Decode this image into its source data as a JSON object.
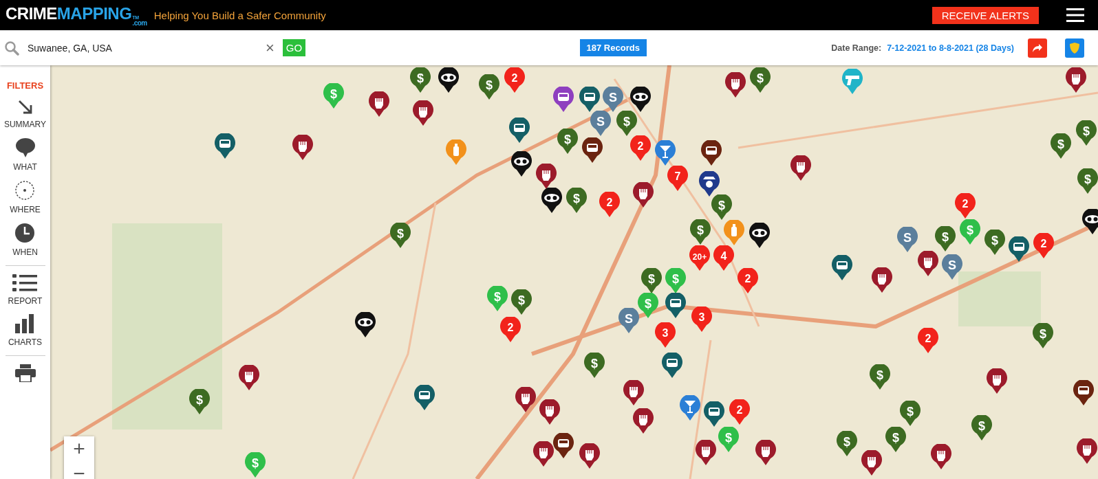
{
  "header": {
    "logo": {
      "primary": "CRIME",
      "secondary": "MAPPING",
      "trademark": "TM",
      "suffix": ".com"
    },
    "tagline": "Helping You Build a Safer Community",
    "alerts_button": "RECEIVE ALERTS"
  },
  "toolbar": {
    "search": {
      "value": "Suwanee, GA, USA"
    },
    "clear_button": "×",
    "go_button": "GO",
    "records": "187 Records",
    "date_range_label": "Date Range:",
    "date_range": "7-12-2021 to 8-8-2021 (28 Days)"
  },
  "sidebar": {
    "title": "FILTERS",
    "items": [
      {
        "kind": "summary",
        "label": "SUMMARY"
      },
      {
        "kind": "what",
        "label": "WHAT"
      },
      {
        "kind": "where",
        "label": "WHERE"
      },
      {
        "kind": "when",
        "label": "WHEN"
      },
      {
        "kind": "report",
        "label": "REPORT"
      },
      {
        "kind": "charts",
        "label": "CHARTS"
      },
      {
        "kind": "print"
      }
    ]
  },
  "map": {
    "zoom_in": "+",
    "zoom_out": "−",
    "markers": [
      {
        "kind": "dollar",
        "label": "$"
      },
      {
        "kind": "mask"
      },
      {
        "kind": "count",
        "label": "2"
      },
      {
        "kind": "dollar",
        "label": "$"
      },
      {
        "kind": "card",
        "label": "$"
      },
      {
        "kind": "fist"
      },
      {
        "kind": "fist"
      },
      {
        "kind": "vandal"
      },
      {
        "kind": "car"
      },
      {
        "kind": "robbery",
        "label": "S"
      },
      {
        "kind": "mask"
      },
      {
        "kind": "robbery",
        "label": "S"
      },
      {
        "kind": "dollar",
        "label": "$"
      },
      {
        "kind": "dollar",
        "label": "$"
      },
      {
        "kind": "auto"
      },
      {
        "kind": "count",
        "label": "2"
      },
      {
        "kind": "cocktail"
      },
      {
        "kind": "car"
      },
      {
        "kind": "car"
      },
      {
        "kind": "fist"
      },
      {
        "kind": "spray"
      },
      {
        "kind": "mask"
      },
      {
        "kind": "fist"
      },
      {
        "kind": "count",
        "label": "7"
      },
      {
        "kind": "auto"
      },
      {
        "kind": "police"
      },
      {
        "kind": "mask"
      },
      {
        "kind": "dollar",
        "label": "$"
      },
      {
        "kind": "count",
        "label": "2"
      },
      {
        "kind": "fist"
      },
      {
        "kind": "dollar",
        "label": "$"
      },
      {
        "kind": "fist"
      },
      {
        "kind": "dollar",
        "label": "$"
      },
      {
        "kind": "spray"
      },
      {
        "kind": "mask"
      },
      {
        "kind": "count",
        "label": "20+"
      },
      {
        "kind": "count",
        "label": "4"
      },
      {
        "kind": "dollar",
        "label": "$"
      },
      {
        "kind": "card",
        "label": "$"
      },
      {
        "kind": "count",
        "label": "2"
      },
      {
        "kind": "car"
      },
      {
        "kind": "card",
        "label": "$"
      },
      {
        "kind": "dollar",
        "label": "$"
      },
      {
        "kind": "mask"
      },
      {
        "kind": "card",
        "label": "$"
      },
      {
        "kind": "dollar",
        "label": "$"
      },
      {
        "kind": "count",
        "label": "2"
      },
      {
        "kind": "robbery",
        "label": "S"
      },
      {
        "kind": "count",
        "label": "3"
      },
      {
        "kind": "count",
        "label": "3"
      },
      {
        "kind": "dollar",
        "label": "$"
      },
      {
        "kind": "car"
      },
      {
        "kind": "fist"
      },
      {
        "kind": "dollar",
        "label": "$"
      },
      {
        "kind": "car"
      },
      {
        "kind": "fist"
      },
      {
        "kind": "fist"
      },
      {
        "kind": "fist"
      },
      {
        "kind": "fist"
      },
      {
        "kind": "cocktail"
      },
      {
        "kind": "car"
      },
      {
        "kind": "count",
        "label": "2"
      },
      {
        "kind": "card",
        "label": "$"
      },
      {
        "kind": "auto"
      },
      {
        "kind": "fist"
      },
      {
        "kind": "fist"
      },
      {
        "kind": "fist"
      },
      {
        "kind": "fist"
      },
      {
        "kind": "card",
        "label": "$"
      },
      {
        "kind": "fist"
      },
      {
        "kind": "dollar",
        "label": "$"
      },
      {
        "kind": "fist"
      },
      {
        "kind": "gun"
      },
      {
        "kind": "fist"
      },
      {
        "kind": "dollar",
        "label": "$"
      },
      {
        "kind": "dollar",
        "label": "$"
      },
      {
        "kind": "count",
        "label": "2"
      },
      {
        "kind": "card",
        "label": "$"
      },
      {
        "kind": "dollar",
        "label": "$"
      },
      {
        "kind": "car"
      },
      {
        "kind": "count",
        "label": "2"
      },
      {
        "kind": "robbery",
        "label": "S"
      },
      {
        "kind": "dollar",
        "label": "$"
      },
      {
        "kind": "fist"
      },
      {
        "kind": "robbery",
        "label": "S"
      },
      {
        "kind": "car"
      },
      {
        "kind": "fist"
      },
      {
        "kind": "mask"
      },
      {
        "kind": "count",
        "label": "2"
      },
      {
        "kind": "dollar",
        "label": "$"
      },
      {
        "kind": "dollar",
        "label": "$"
      },
      {
        "kind": "fist"
      },
      {
        "kind": "dollar",
        "label": "$"
      },
      {
        "kind": "dollar",
        "label": "$"
      },
      {
        "kind": "auto"
      },
      {
        "kind": "dollar",
        "label": "$"
      },
      {
        "kind": "dollar",
        "label": "$"
      },
      {
        "kind": "fist"
      },
      {
        "kind": "fist"
      },
      {
        "kind": "dollar",
        "label": "$"
      }
    ]
  }
}
